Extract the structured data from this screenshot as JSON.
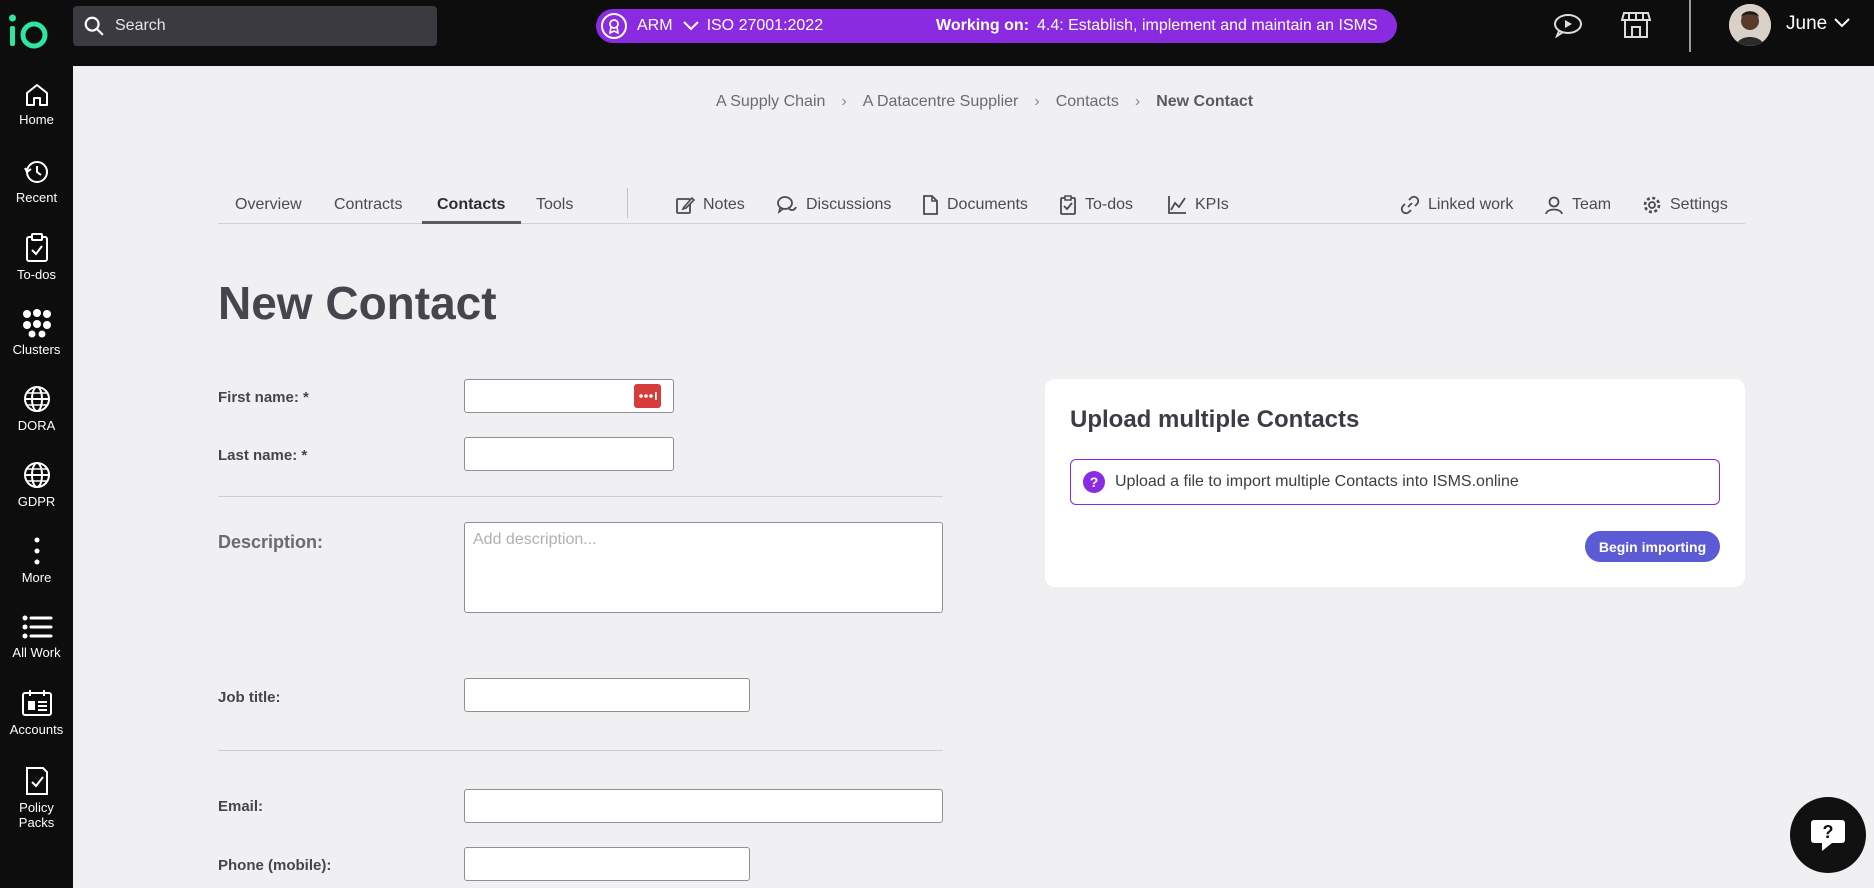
{
  "topbar": {
    "search_placeholder": "Search",
    "framework_short": "ARM",
    "framework": "ISO 27001:2022",
    "working_on_label": "Working on:",
    "working_on_value": "4.4: Establish, implement and maintain an ISMS",
    "user_name": "June",
    "accent": "#8a2be2"
  },
  "sidebar": {
    "items": [
      {
        "label": "Home",
        "icon": "home-icon"
      },
      {
        "label": "Recent",
        "icon": "history-icon"
      },
      {
        "label": "To-dos",
        "icon": "clipboard-check-icon"
      },
      {
        "label": "Clusters",
        "icon": "clusters-icon"
      },
      {
        "label": "DORA",
        "icon": "globe-icon"
      },
      {
        "label": "GDPR",
        "icon": "globe-icon"
      },
      {
        "label": "More",
        "icon": "more-vertical-icon"
      },
      {
        "label": "All Work",
        "icon": "list-icon"
      },
      {
        "label": "Accounts",
        "icon": "accounts-icon"
      },
      {
        "label": "Policy Packs",
        "icon": "policy-pack-icon"
      }
    ]
  },
  "breadcrumb": {
    "items": [
      "A Supply Chain",
      "A Datacentre Supplier",
      "Contacts"
    ],
    "current": "New Contact"
  },
  "tabs": {
    "left": [
      "Overview",
      "Contracts",
      "Contacts",
      "Tools"
    ],
    "active": "Contacts",
    "middle": [
      "Notes",
      "Discussions",
      "Documents",
      "To-dos",
      "KPIs"
    ],
    "right": [
      "Linked work",
      "Team",
      "Settings"
    ]
  },
  "form": {
    "title": "New Contact",
    "first_name_label": "First name: *",
    "last_name_label": "Last name: *",
    "description_label": "Description:",
    "description_placeholder": "Add description...",
    "job_title_label": "Job title:",
    "email_label": "Email:",
    "phone_label": "Phone (mobile):"
  },
  "upload": {
    "title": "Upload multiple Contacts",
    "info": "Upload a file to import multiple Contacts into ISMS.online",
    "button": "Begin importing"
  }
}
